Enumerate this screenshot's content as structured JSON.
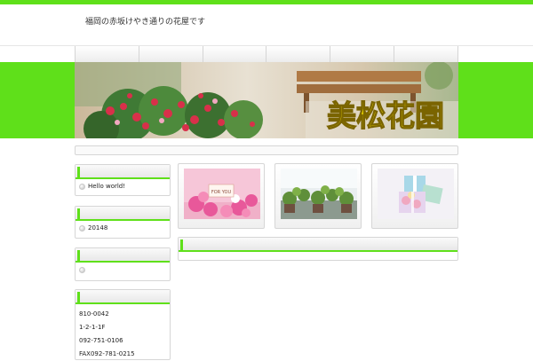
{
  "header": {
    "tagline": "福岡の赤坂けやき通りの花屋です"
  },
  "nav": {
    "items": [
      "",
      "",
      "",
      "",
      "",
      ""
    ]
  },
  "hero": {
    "title": "美松花園"
  },
  "sidebar": {
    "recent_posts": {
      "item": "Hello world!"
    },
    "archives": {
      "item": "20148"
    },
    "categories": {
      "item": ""
    },
    "info": [
      "810-0042",
      "1-2-1-1F",
      "092-751-0106",
      "FAX092-781-0215"
    ]
  },
  "thumbnails": [
    {
      "caption": "FOR YOU"
    },
    {
      "caption": ""
    },
    {
      "caption": ""
    }
  ],
  "colors": {
    "accent": "#5fe01a",
    "hero_title": "#f5e000"
  }
}
